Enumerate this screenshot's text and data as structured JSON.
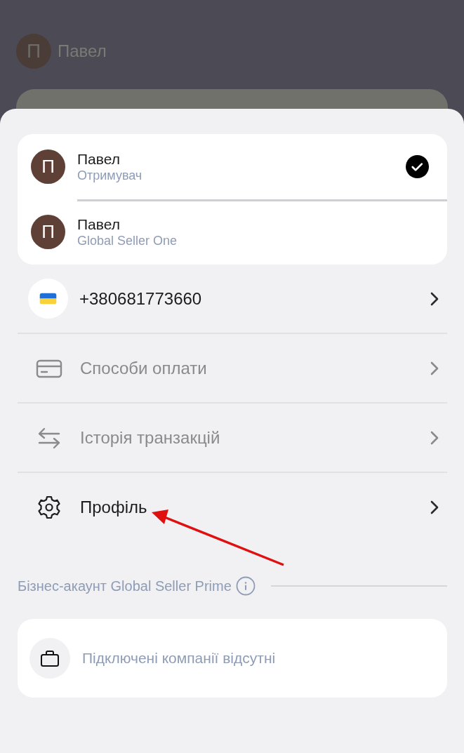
{
  "background": {
    "user": {
      "initial": "П",
      "name": "Павел"
    }
  },
  "accounts": [
    {
      "initial": "П",
      "name": "Павел",
      "role": "Отримувач",
      "selected": true
    },
    {
      "initial": "П",
      "name": "Павел",
      "role": "Global Seller One",
      "selected": false
    }
  ],
  "menu": [
    {
      "kind": "phone",
      "label": "+380681773660",
      "disabled": false
    },
    {
      "kind": "card",
      "label": "Способи оплати",
      "disabled": true
    },
    {
      "kind": "transfer",
      "label": "Історія транзакцій",
      "disabled": true
    },
    {
      "kind": "settings",
      "label": "Профіль",
      "disabled": false
    }
  ],
  "business": {
    "title": "Бізнес-акаунт Global Seller Prime",
    "empty_text": "Підключені компанії відсутні"
  }
}
